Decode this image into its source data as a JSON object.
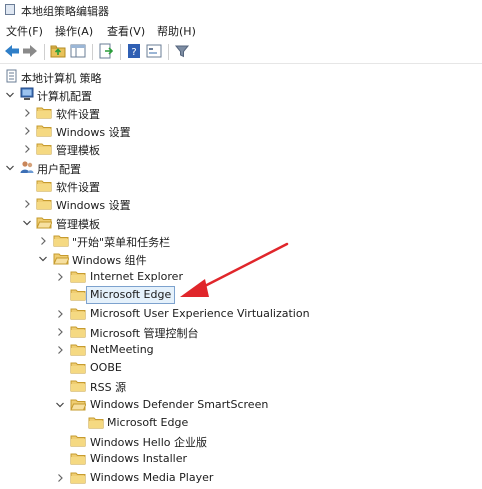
{
  "window": {
    "title": "本地组策略编辑器"
  },
  "menu": [
    "文件(F)",
    "操作(A)",
    "查看(V)",
    "帮助(H)"
  ],
  "toolbar": {
    "buttons": [
      "back-icon",
      "forward-icon",
      "up-folder-icon",
      "show-hide-tree-icon",
      "export-list-icon",
      "help-icon",
      "properties-icon",
      "filter-icon"
    ]
  },
  "tree": {
    "root": "本地计算机 策略",
    "computer_config": "计算机配置",
    "cc_software": "软件设置",
    "cc_windows": "Windows 设置",
    "cc_admin": "管理模板",
    "user_config": "用户配置",
    "uc_software": "软件设置",
    "uc_windows": "Windows 设置",
    "uc_admin": "管理模板",
    "start_menu": "\"开始\"菜单和任务栏",
    "win_components": "Windows 组件",
    "ie": "Internet Explorer",
    "edge": "Microsoft Edge",
    "uev": "Microsoft User Experience Virtualization",
    "mmc": "Microsoft 管理控制台",
    "netmeeting": "NetMeeting",
    "oobe": "OOBE",
    "rss": "RSS 源",
    "smartscreen": "Windows Defender SmartScreen",
    "ss_edge": "Microsoft Edge",
    "hello": "Windows Hello 企业版",
    "installer": "Windows Installer",
    "media_player": "Windows Media Player"
  },
  "annotation": {
    "arrow_color": "#e0262b"
  },
  "colors": {
    "folder": "#e8c25a",
    "selection_border": "#7da2ce"
  }
}
